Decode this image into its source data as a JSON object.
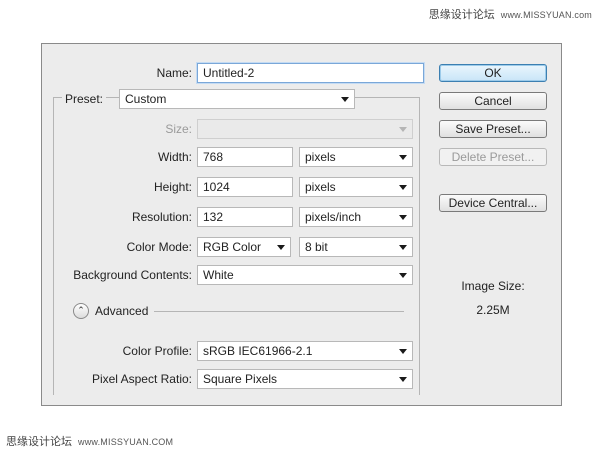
{
  "watermark": {
    "top_text": "思缘设计论坛",
    "top_url": "www.MISSYUAN.com",
    "bottom_text": "思缘设计论坛",
    "bottom_url": "www.MISSYUAN.COM"
  },
  "fields": {
    "name_label": "Name:",
    "name_value": "Untitled-2",
    "preset_label": "Preset:",
    "preset_value": "Custom",
    "size_label": "Size:",
    "size_value": "",
    "width_label": "Width:",
    "width_value": "768",
    "width_unit": "pixels",
    "height_label": "Height:",
    "height_value": "1024",
    "height_unit": "pixels",
    "resolution_label": "Resolution:",
    "resolution_value": "132",
    "resolution_unit": "pixels/inch",
    "color_mode_label": "Color Mode:",
    "color_mode_value": "RGB Color",
    "bit_depth_value": "8 bit",
    "background_label": "Background Contents:",
    "background_value": "White",
    "advanced_label": "Advanced",
    "color_profile_label": "Color Profile:",
    "color_profile_value": "sRGB IEC61966-2.1",
    "aspect_label": "Pixel Aspect Ratio:",
    "aspect_value": "Square Pixels"
  },
  "buttons": {
    "ok": "OK",
    "cancel": "Cancel",
    "save_preset": "Save Preset...",
    "delete_preset": "Delete Preset...",
    "device_central": "Device Central..."
  },
  "image_size": {
    "label": "Image Size:",
    "value": "2.25M"
  },
  "icons": {
    "advanced_toggle": "chevron-double-up-icon",
    "dropdown_arrow": "caret-down-icon"
  },
  "colors": {
    "dialog_bg": "#ececec",
    "focus_blue": "#7aa7d8",
    "default_button_blue": "#3c7fb1"
  }
}
